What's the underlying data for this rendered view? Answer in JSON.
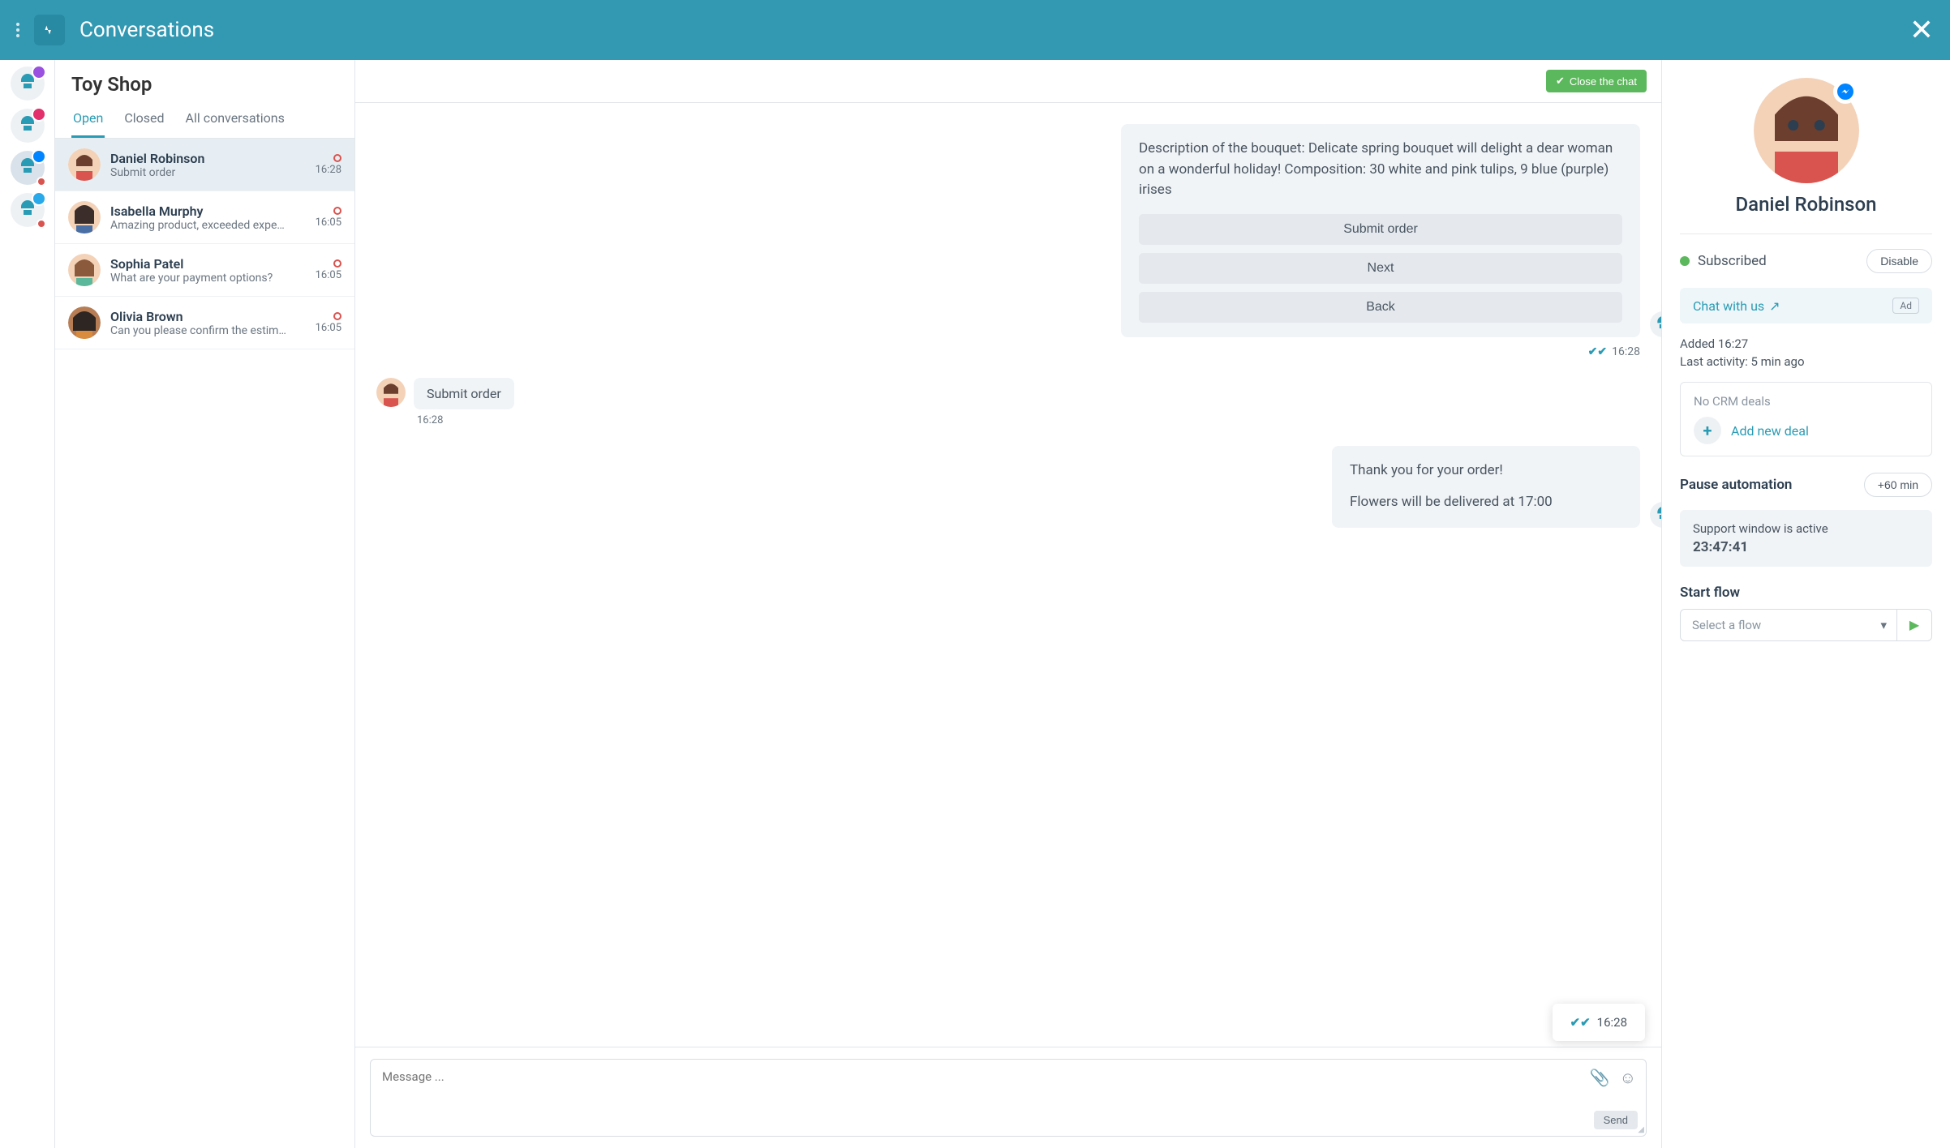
{
  "header": {
    "title": "Conversations"
  },
  "shop_name": "Toy Shop",
  "tabs": {
    "open": "Open",
    "closed": "Closed",
    "all": "All conversations"
  },
  "close_chat_label": "Close the chat",
  "conversations": {
    "0": {
      "name": "Daniel Robinson",
      "preview": "Submit order",
      "time": "16:28"
    },
    "1": {
      "name": "Isabella Murphy",
      "preview": "Amazing product, exceeded expe…",
      "time": "16:05"
    },
    "2": {
      "name": "Sophia Patel",
      "preview": "What are your payment options?",
      "time": "16:05"
    },
    "3": {
      "name": "Olivia Brown",
      "preview": "Can you please confirm the estim…",
      "time": "16:05"
    }
  },
  "chat": {
    "bot_card": {
      "text": "Description of the bouquet: Delicate spring bouquet will delight a dear woman on a wonderful holiday! Composition: 30 white and pink tulips, 9 blue (purple) irises",
      "options": {
        "submit": "Submit order",
        "next": "Next",
        "back": "Back"
      },
      "time": "16:28"
    },
    "user_msg": {
      "text": "Submit order",
      "time": "16:28"
    },
    "bot_reply": {
      "line1": "Thank you for your order!",
      "line2": "Flowers will be delivered at 17:00",
      "time": "16:28"
    }
  },
  "composer": {
    "placeholder": "Message ...",
    "send": "Send"
  },
  "profile": {
    "name": "Daniel Robinson",
    "subscribed": "Subscribed",
    "disable": "Disable",
    "chat_link": "Chat with us",
    "ad": "Ad",
    "added": "Added 16:27",
    "last_activity": "Last activity: 5 min ago",
    "no_crm": "No CRM deals",
    "add_deal": "Add new deal",
    "pause": "Pause automation",
    "pause_btn": "+60 min",
    "support_active": "Support window is active",
    "countdown": "23:47:41",
    "start_flow": "Start flow",
    "select_flow": "Select a flow"
  }
}
